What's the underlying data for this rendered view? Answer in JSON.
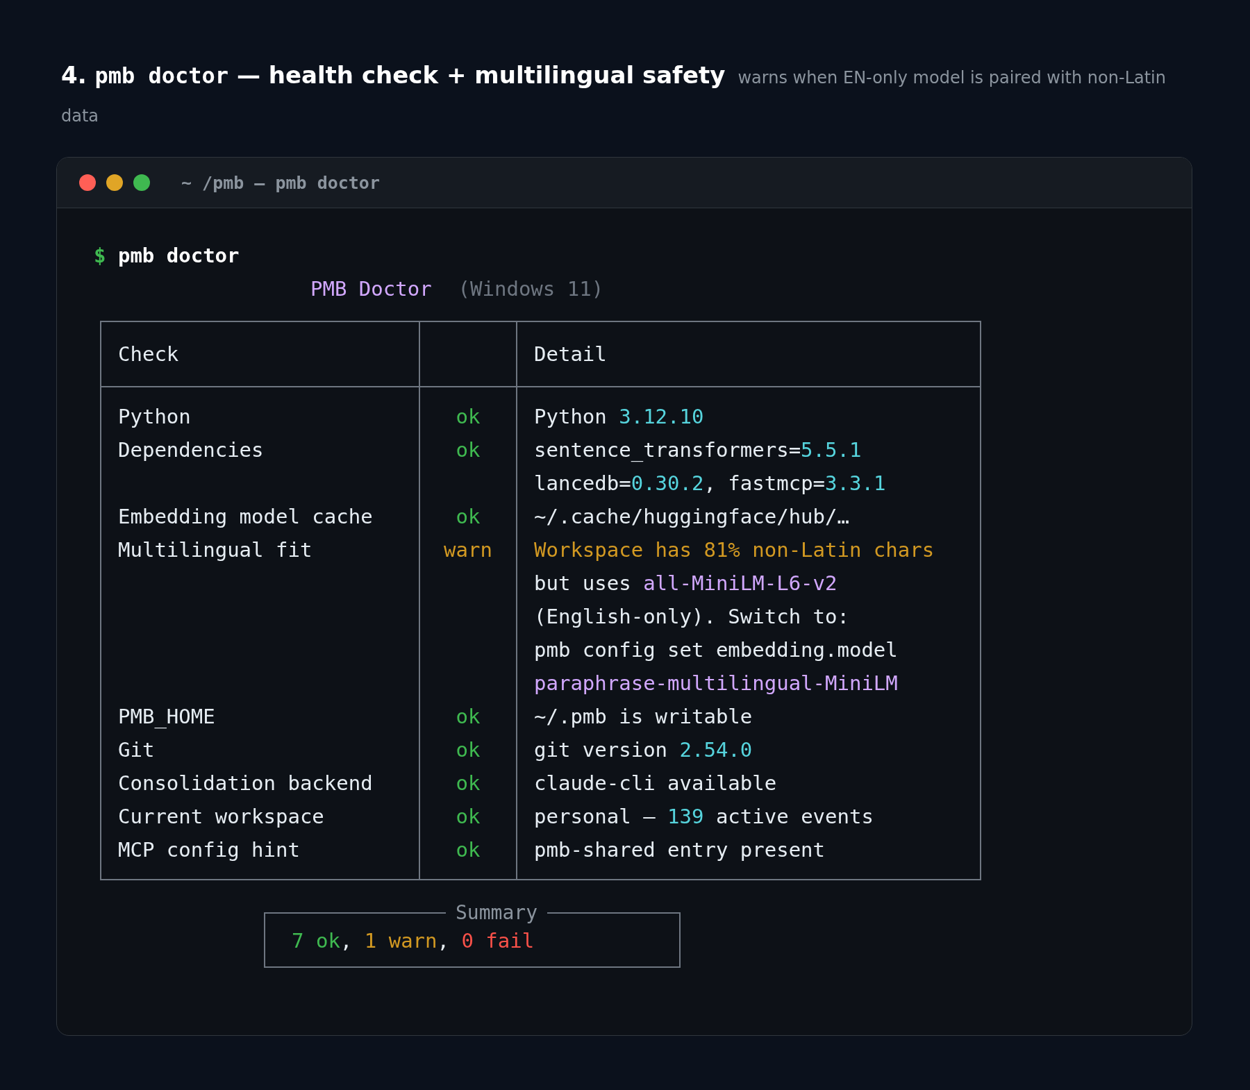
{
  "heading": {
    "segments": [
      {
        "kind": "text",
        "text": "4. "
      },
      {
        "kind": "code",
        "text": "pmb  doctor"
      },
      {
        "kind": "text",
        "text": " — health check + multilingual safety"
      }
    ],
    "subtitle": "warns when EN-only model is paired with non-Latin data"
  },
  "window": {
    "title": "~ /pmb — pmb doctor"
  },
  "prompt": {
    "symbol": "$",
    "command": "pmb doctor"
  },
  "report": {
    "title": "PMB Doctor",
    "platform": "(Windows 11)"
  },
  "table": {
    "columns": [
      "Check",
      "Detail"
    ],
    "rows": [
      {
        "check": "Python",
        "status": "ok",
        "kind": "ok",
        "detail": [
          [
            {
              "kind": "plain",
              "text": "Python "
            },
            {
              "kind": "number",
              "text": "3.12.10"
            }
          ]
        ]
      },
      {
        "check": "Dependencies",
        "status": "ok",
        "kind": "ok",
        "detail": [
          [
            {
              "kind": "plain",
              "text": "sentence_transformers="
            },
            {
              "kind": "number",
              "text": "5.5.1"
            }
          ],
          [
            {
              "kind": "plain",
              "text": "lancedb="
            },
            {
              "kind": "number",
              "text": "0.30.2"
            },
            {
              "kind": "plain",
              "text": ", fastmcp="
            },
            {
              "kind": "number",
              "text": "3.3.1"
            }
          ]
        ]
      },
      {
        "check": "Embedding model cache",
        "status": "ok",
        "kind": "ok",
        "detail": [
          [
            {
              "kind": "plain",
              "text": "~/.cache/huggingface/hub/…"
            }
          ]
        ]
      },
      {
        "check": "Multilingual fit",
        "status": "warn",
        "kind": "warn",
        "detail": [
          [
            {
              "kind": "warn",
              "text": "Workspace has 81% non-Latin chars"
            }
          ],
          [
            {
              "kind": "plain",
              "text": "but uses "
            },
            {
              "kind": "model",
              "text": "all-MiniLM-L6-v2"
            }
          ],
          [
            {
              "kind": "plain",
              "text": "(English-only). Switch to:"
            }
          ],
          [
            {
              "kind": "plain",
              "text": "pmb config set embedding.model"
            }
          ],
          [
            {
              "kind": "model",
              "text": "paraphrase-multilingual-MiniLM"
            }
          ]
        ]
      },
      {
        "check": "PMB_HOME",
        "status": "ok",
        "kind": "ok",
        "detail": [
          [
            {
              "kind": "plain",
              "text": "~/.pmb is writable"
            }
          ]
        ]
      },
      {
        "check": "Git",
        "status": "ok",
        "kind": "ok",
        "detail": [
          [
            {
              "kind": "plain",
              "text": "git version "
            },
            {
              "kind": "number",
              "text": "2.54.0"
            }
          ]
        ]
      },
      {
        "check": "Consolidation backend",
        "status": "ok",
        "kind": "ok",
        "detail": [
          [
            {
              "kind": "plain",
              "text": "claude-cli available"
            }
          ]
        ]
      },
      {
        "check": "Current workspace",
        "status": "ok",
        "kind": "ok",
        "detail": [
          [
            {
              "kind": "plain",
              "text": "personal — "
            },
            {
              "kind": "number",
              "text": "139"
            },
            {
              "kind": "plain",
              "text": " active events"
            }
          ]
        ]
      },
      {
        "check": "MCP config hint",
        "status": "ok",
        "kind": "ok",
        "detail": [
          [
            {
              "kind": "plain",
              "text": "pmb-shared entry present"
            }
          ]
        ]
      }
    ]
  },
  "summary": {
    "title": "Summary",
    "segments": [
      {
        "kind": "ok",
        "text": "7 ok"
      },
      {
        "kind": "plain",
        "text": ", "
      },
      {
        "kind": "warn",
        "text": "1 warn"
      },
      {
        "kind": "plain",
        "text": ", "
      },
      {
        "kind": "fail",
        "text": "0 fail"
      }
    ]
  }
}
